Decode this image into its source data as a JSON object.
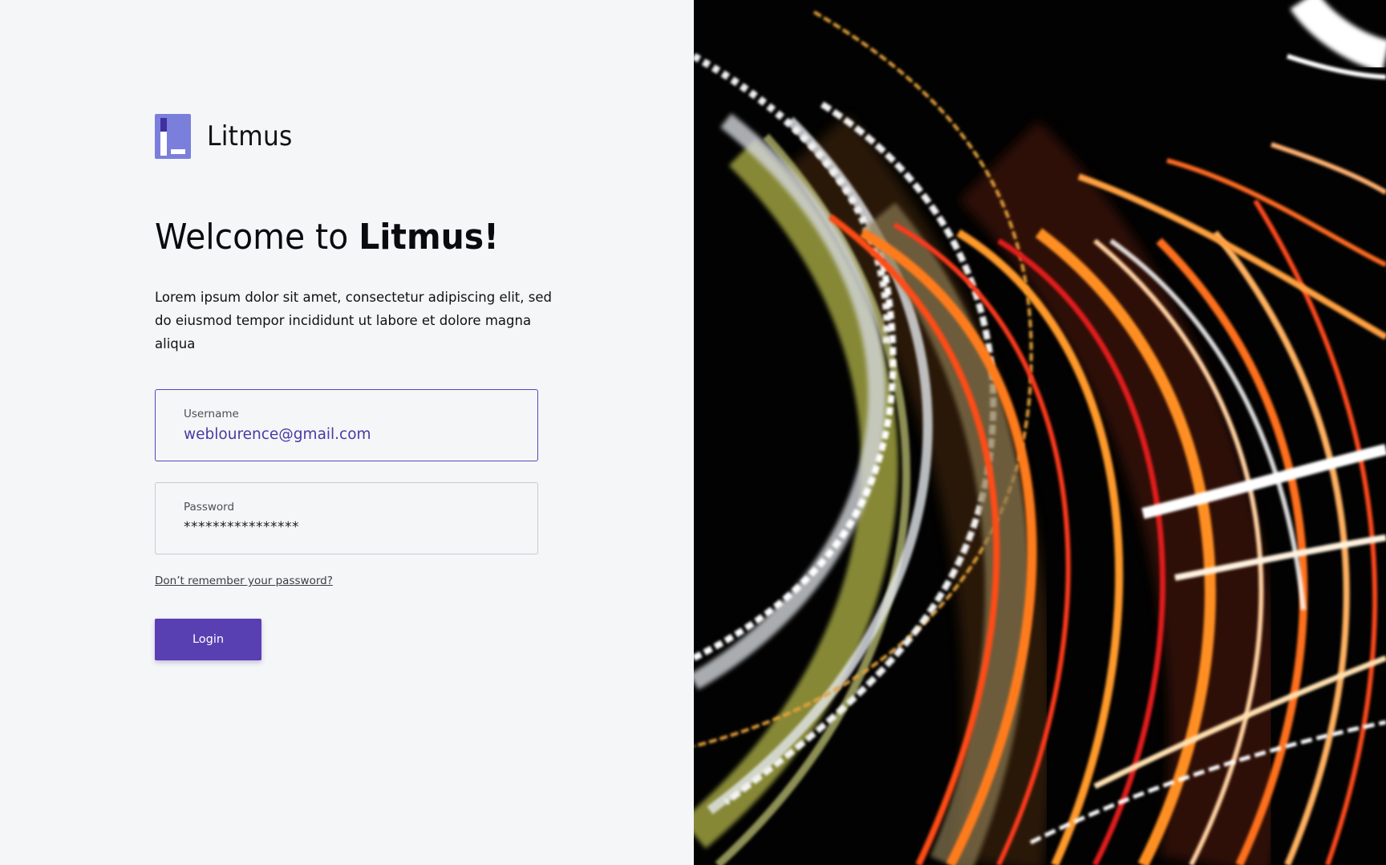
{
  "brand": {
    "name": "Litmus",
    "icon": "litmus-logo-icon"
  },
  "welcome": {
    "prefix": "Welcome to ",
    "emphasis": "Litmus!"
  },
  "intro": {
    "text": "Lorem ipsum dolor sit amet, consectetur adipiscing elit, sed do eiusmod tempor incididunt ut labore et dolore magna aliqua"
  },
  "form": {
    "username": {
      "label": "Username",
      "value": "weblourence@gmail.com"
    },
    "password": {
      "label": "Password",
      "value": "****************"
    },
    "forgot_link": "Don’t remember your password?",
    "login_button": "Login"
  },
  "hero_image": {
    "icon": "light-trails-image"
  },
  "colors": {
    "accent": "#5840b2",
    "focused_border": "#5b44ba",
    "username_text": "#4a39a4",
    "background": "#f5f6f8",
    "logo_light": "#7b7fdc",
    "logo_dark": "#3f2f9f"
  }
}
